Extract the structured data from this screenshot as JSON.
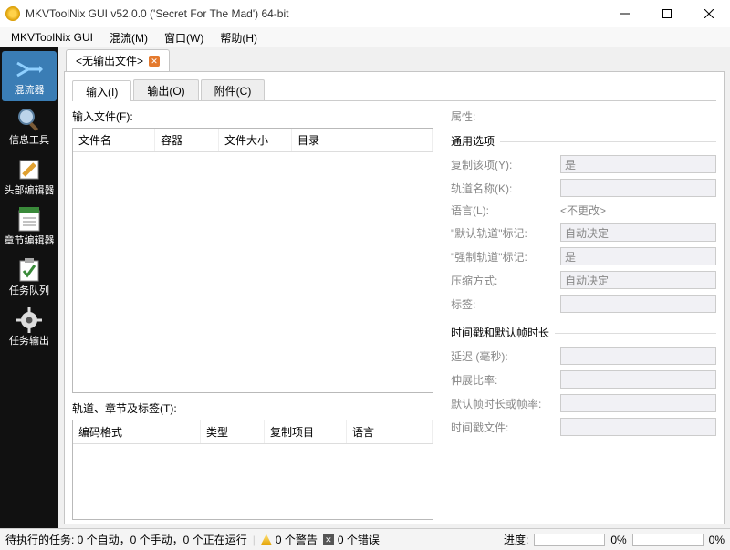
{
  "titlebar": {
    "title": "MKVToolNix GUI v52.0.0 ('Secret For The Mad') 64-bit"
  },
  "menubar": {
    "items": [
      "MKVToolNix GUI",
      "混流(M)",
      "窗口(W)",
      "帮助(H)"
    ]
  },
  "sidebar": {
    "items": [
      {
        "label": "混流器"
      },
      {
        "label": "信息工具"
      },
      {
        "label": "头部编辑器"
      },
      {
        "label": "章节编辑器"
      },
      {
        "label": "任务队列"
      },
      {
        "label": "任务输出"
      }
    ]
  },
  "doc_tab": {
    "label": "<无输出文件>"
  },
  "inner_tabs": {
    "input": "输入(I)",
    "output": "输出(O)",
    "attach": "附件(C)"
  },
  "left": {
    "input_files_label": "输入文件(F):",
    "cols": {
      "name": "文件名",
      "container": "容器",
      "size": "文件大小",
      "dir": "目录"
    },
    "tracks_label": "轨道、章节及标签(T):",
    "tcols": {
      "codec": "编码格式",
      "type": "类型",
      "copy": "复制项目",
      "lang": "语言"
    }
  },
  "right": {
    "props_label": "属性:",
    "group_general": "通用选项",
    "copy_item": {
      "label": "复制该项(Y):",
      "value": "是"
    },
    "track_name": {
      "label": "轨道名称(K):",
      "value": ""
    },
    "language": {
      "label": "语言(L):",
      "value": "<不更改>"
    },
    "default_flag": {
      "label": "\"默认轨道\"标记:",
      "value": "自动决定"
    },
    "forced_flag": {
      "label": "\"强制轨道\"标记:",
      "value": "是"
    },
    "compression": {
      "label": "压缩方式:",
      "value": "自动决定"
    },
    "tags": {
      "label": "标签:",
      "value": ""
    },
    "group_time": "时间戳和默认帧时长",
    "delay": {
      "label": "延迟 (毫秒):",
      "value": ""
    },
    "stretch": {
      "label": "伸展比率:",
      "value": ""
    },
    "def_dur": {
      "label": "默认帧时长或帧率:",
      "value": ""
    },
    "ts_file": {
      "label": "时间戳文件:",
      "value": ""
    }
  },
  "status": {
    "tasks": "待执行的任务: 0 个自动，0 个手动，0 个正在运行",
    "warnings": "0 个警告",
    "errors": "0 个错误",
    "progress_label": "进度:",
    "pct1": "0%",
    "pct2": "0%"
  }
}
